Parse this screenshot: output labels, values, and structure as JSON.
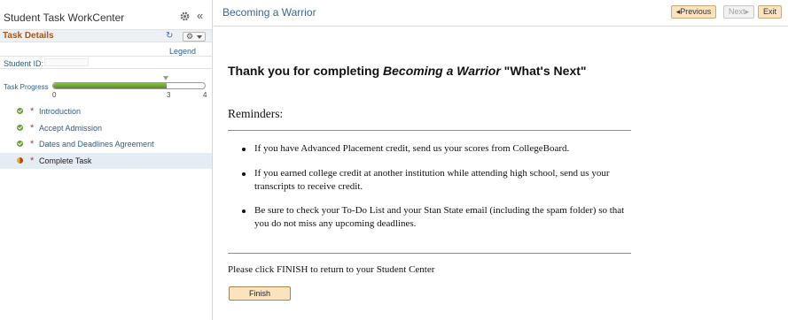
{
  "workcenter": {
    "title": "Student Task WorkCenter",
    "collapse_glyph": "«"
  },
  "task_details": {
    "label": "Task Details",
    "refresh_glyph": "↻",
    "gear_glyph": "⚙",
    "legend_label": "Legend"
  },
  "student": {
    "id_label": "Student ID:",
    "id_value": ""
  },
  "progress": {
    "label": "Task Progress",
    "current": 3,
    "total": 4,
    "ticks": [
      "0",
      "3",
      "4"
    ]
  },
  "tasks": [
    {
      "label": "Introduction",
      "status": "complete",
      "required": "*"
    },
    {
      "label": "Accept Admission",
      "status": "complete",
      "required": "*"
    },
    {
      "label": "Dates and Deadlines Agreement",
      "status": "complete",
      "required": "*"
    },
    {
      "label": "Complete Task",
      "status": "in-progress",
      "required": "*",
      "active": true
    }
  ],
  "header": {
    "page_title": "Becoming a Warrior",
    "previous_label": "◂Previous",
    "next_label": "Next▸",
    "exit_label": "Exit"
  },
  "main": {
    "thanks_prefix": "Thank you for completing ",
    "thanks_title": "Becoming a Warrior",
    "thanks_suffix": " \"What's Next\"",
    "reminders_heading": "Reminders:",
    "reminders": [
      "If you have Advanced Placement credit, send us your scores from CollegeBoard.",
      "If you earned college credit at another institution while attending high school, send us your transcripts to receive credit.",
      "Be sure to check your To-Do List and your Stan State email (including the spam folder) so that you do not miss any upcoming deadlines."
    ],
    "finish_instruction": "Please click FINISH to return to your Student Center",
    "finish_label": "Finish"
  },
  "colors": {
    "accent_orange": "#a3581d",
    "link_blue": "#2f5d8a",
    "button_fill": "#fbe3bd",
    "progress_green": "#67a33a"
  }
}
